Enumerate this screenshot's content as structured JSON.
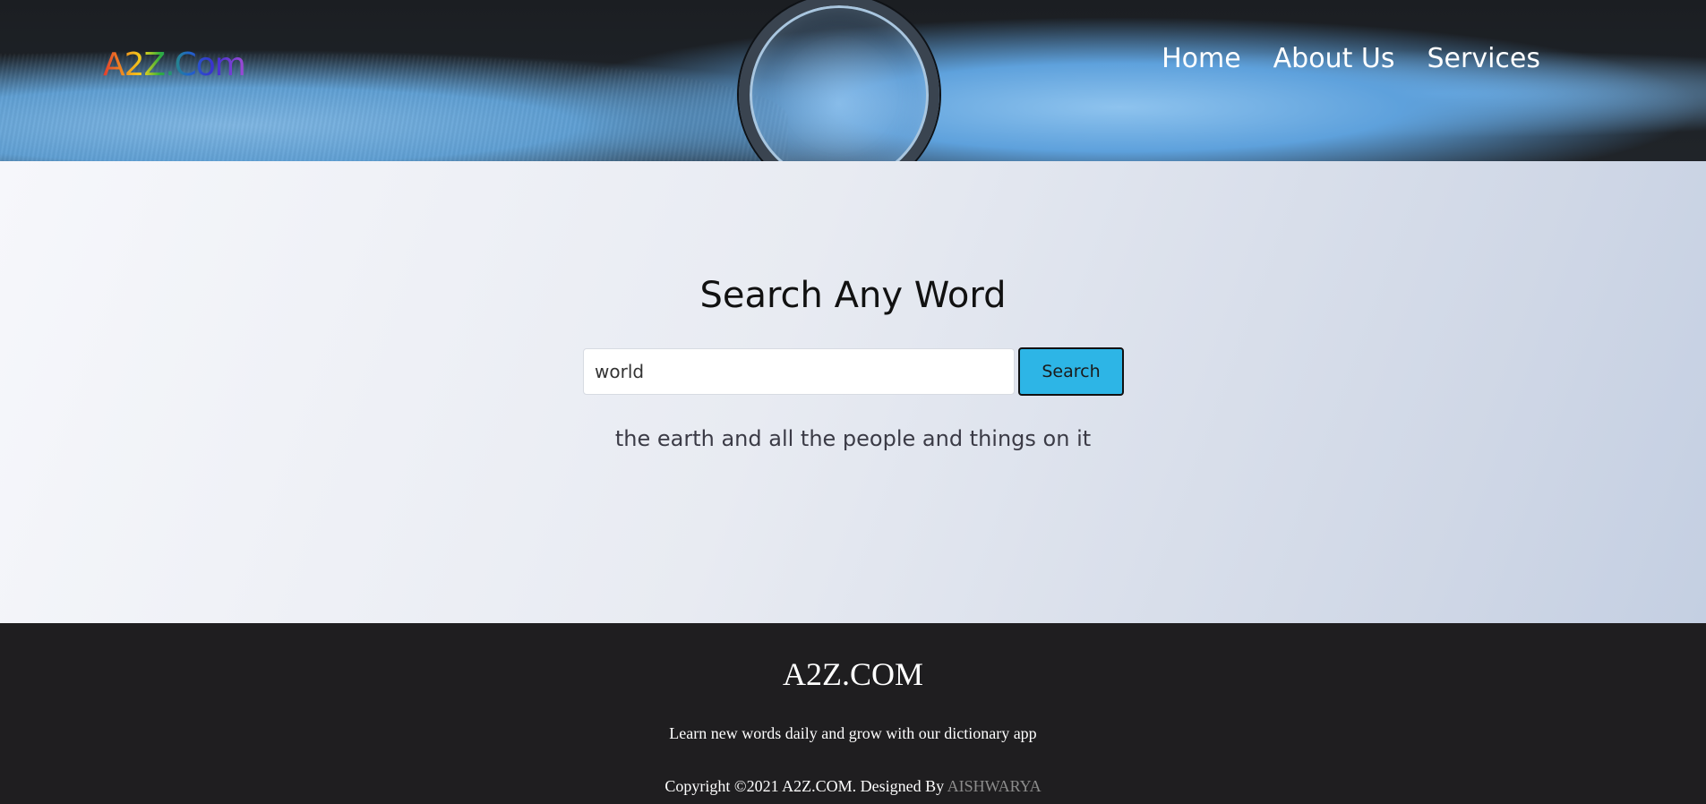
{
  "header": {
    "logo": "A2Z.Com",
    "nav": [
      {
        "label": "Home"
      },
      {
        "label": "About Us"
      },
      {
        "label": "Services"
      }
    ]
  },
  "main": {
    "title": "Search Any Word",
    "search": {
      "value": "world",
      "button_label": "Search"
    },
    "definition": "the earth and all the people and things on it"
  },
  "footer": {
    "title": "A2Z.COM",
    "tagline": "Learn new words daily and grow with our dictionary app",
    "copyright": "Copyright ©2021 A2Z.COM. Designed By",
    "designer": "AISHWARYA"
  },
  "colors": {
    "button": "#2db5e6",
    "footer_bg": "#1f1e20",
    "designer_link": "#8c8c8c"
  }
}
